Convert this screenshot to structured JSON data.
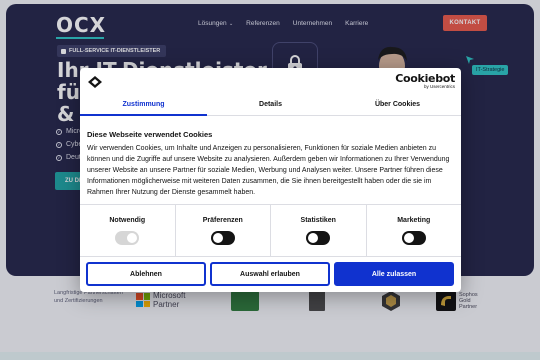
{
  "page": {
    "logo": "OCX",
    "nav": [
      "Lösungen",
      "Referenzen",
      "Unternehmen",
      "Karriere"
    ],
    "contact_label": "KONTAKT",
    "badge": "FULL-SERVICE IT-DIENSTLEISTER",
    "headline_lines": [
      "Ihr IT-Dienstleister",
      "für",
      "& C"
    ],
    "bullets": [
      "Micro",
      "Cyber",
      "Deuts"
    ],
    "cta_label": "ZU DE",
    "strategy_tag": "IT-Strategie",
    "partners_label": "Langfristige Partnerschaften und Zertifizierungen",
    "ms_line1": "Microsoft",
    "ms_line2": "Partner",
    "sophos_text": [
      "Sophos",
      "Gold",
      "Partner"
    ],
    "colors": {
      "hero_bg": "#25264a",
      "accent_teal": "#2ec4c4",
      "contact_red": "#e8594a"
    }
  },
  "cookie_dialog": {
    "brand": "Cookiebot",
    "brand_sub": "by Usercentrics",
    "tabs": [
      "Zustimmung",
      "Details",
      "Über Cookies"
    ],
    "active_tab": "Zustimmung",
    "title": "Diese Webseite verwendet Cookies",
    "body": "Wir verwenden Cookies, um Inhalte und Anzeigen zu personalisieren, Funktionen für soziale Medien anbieten zu können und die Zugriffe auf unsere Website zu analysieren. Außerdem geben wir Informationen zu Ihrer Verwendung unserer Website an unsere Partner für soziale Medien, Werbung und Analysen weiter. Unsere Partner führen diese Informationen möglicherweise mit weiteren Daten zusammen, die Sie ihnen bereitgestellt haben oder die sie im Rahmen Ihrer Nutzung der Dienste gesammelt haben.",
    "consents": [
      {
        "label": "Notwendig",
        "enabled": true,
        "locked": true
      },
      {
        "label": "Präferenzen",
        "enabled": false,
        "locked": false
      },
      {
        "label": "Statistiken",
        "enabled": false,
        "locked": false
      },
      {
        "label": "Marketing",
        "enabled": false,
        "locked": false
      }
    ],
    "buttons": {
      "decline": "Ablehnen",
      "select": "Auswahl erlauben",
      "accept": "Alle zulassen"
    },
    "colors": {
      "primary": "#1032cf",
      "toggle_off": "#141414",
      "toggle_locked": "#d6d6d6"
    }
  }
}
